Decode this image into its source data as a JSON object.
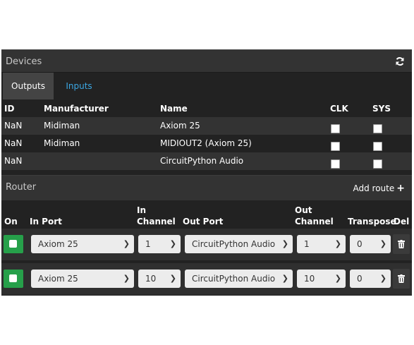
{
  "devices": {
    "title": "Devices",
    "tabs": [
      {
        "label": "Outputs",
        "active": true
      },
      {
        "label": "Inputs",
        "active": false
      }
    ],
    "columns": [
      "ID",
      "Manufacturer",
      "Name",
      "CLK",
      "SYS"
    ],
    "rows": [
      {
        "id": "NaN",
        "manufacturer": "Midiman",
        "name": "Axiom 25",
        "clk": false,
        "sys": false
      },
      {
        "id": "NaN",
        "manufacturer": "Midiman",
        "name": "MIDIOUT2 (Axiom 25)",
        "clk": false,
        "sys": false
      },
      {
        "id": "NaN",
        "manufacturer": "",
        "name": "CircuitPython Audio",
        "clk": false,
        "sys": false
      }
    ]
  },
  "router": {
    "title": "Router",
    "add_route_label": "Add route",
    "columns": {
      "on": "On",
      "in_port": "In Port",
      "in_channel_1": "In",
      "in_channel_2": "Channel",
      "out_port": "Out Port",
      "out_channel_1": "Out",
      "out_channel_2": "Channel",
      "transpose": "Transpose",
      "del": "Del"
    },
    "routes": [
      {
        "on": true,
        "in_port": "Axiom 25",
        "in_channel": "1",
        "out_port": "CircuitPython Audio",
        "out_channel": "1",
        "transpose": "0"
      },
      {
        "on": true,
        "in_port": "Axiom 25",
        "in_channel": "10",
        "out_port": "CircuitPython Audio",
        "out_channel": "10",
        "transpose": "0"
      }
    ]
  },
  "colors": {
    "accent_green": "#26a04a",
    "tab_link": "#3ba7e3",
    "panel_bg": "#222222",
    "header_bg": "#333333"
  }
}
